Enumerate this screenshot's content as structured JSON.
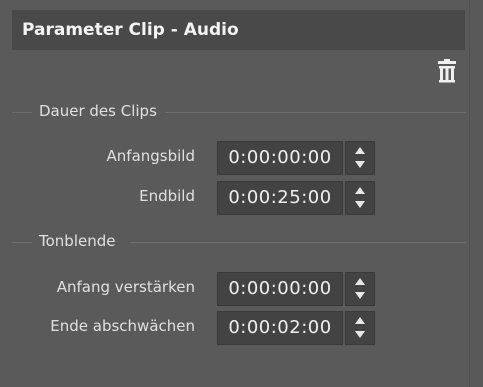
{
  "panel": {
    "title": "Parameter Clip - Audio",
    "delete_icon": "trash-icon"
  },
  "sections": {
    "duration": {
      "label": "Dauer des Clips",
      "fields": [
        {
          "label": "Anfangsbild",
          "value": "0:00:00:00"
        },
        {
          "label": "Endbild",
          "value": "0:00:25:00"
        }
      ]
    },
    "fade": {
      "label": "Tonblende",
      "fields": [
        {
          "label": "Anfang verstärken",
          "value": "0:00:00:00"
        },
        {
          "label": "Ende abschwächen",
          "value": "0:00:02:00"
        }
      ]
    }
  },
  "colors": {
    "background": "#5a5a5a",
    "header": "#494949",
    "field": "#434343",
    "text": "#e0e0e0"
  }
}
